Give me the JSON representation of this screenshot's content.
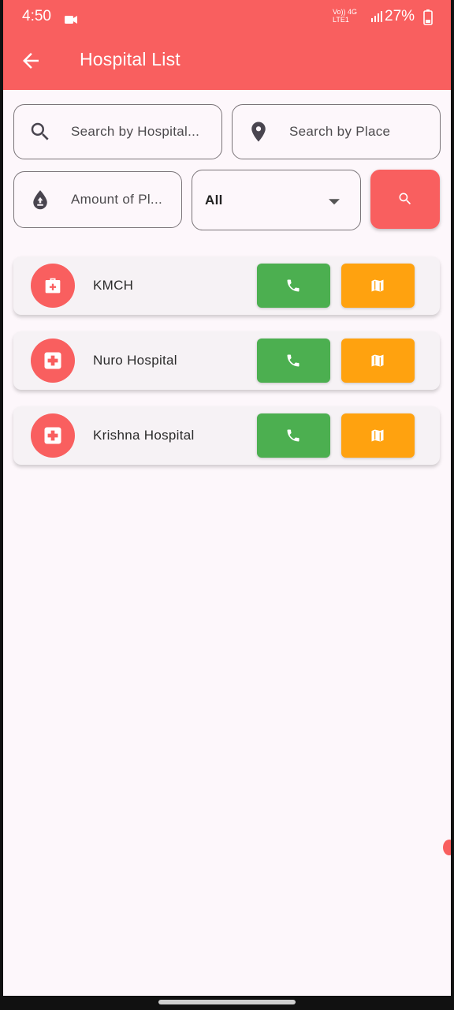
{
  "status_bar": {
    "time": "4:50",
    "network_label": "Vo)) 4G LTE1",
    "battery_percent": "27%",
    "icons": [
      "video-camera-icon",
      "signal-icon",
      "battery-icon"
    ]
  },
  "app_bar": {
    "title": "Hospital List",
    "back_icon": "arrow-back-icon",
    "background_color": "#f95f5f"
  },
  "filters": {
    "hospital_search": {
      "placeholder": "Search by Hospital...",
      "value": "",
      "icon": "search-icon"
    },
    "place_search": {
      "placeholder": "Search by Place",
      "value": "",
      "icon": "location-pin-icon"
    },
    "amount_field": {
      "placeholder": "Amount of Pl...",
      "value": "",
      "icon": "blood-drop-icon"
    },
    "blood_type_dropdown": {
      "selected": "All",
      "icon": "chevron-down-icon"
    },
    "search_button": {
      "icon": "search-icon",
      "color": "#f95f5f"
    }
  },
  "hospitals": [
    {
      "name": "KMCH",
      "icon": "medical-bag-icon"
    },
    {
      "name": "Nuro Hospital",
      "icon": "hospital-cross-icon"
    },
    {
      "name": "Krishna Hospital",
      "icon": "hospital-cross-icon"
    }
  ],
  "actions": {
    "call": {
      "icon": "phone-icon",
      "color": "#4caf50"
    },
    "map": {
      "icon": "map-icon",
      "color": "#ffa20f"
    }
  }
}
